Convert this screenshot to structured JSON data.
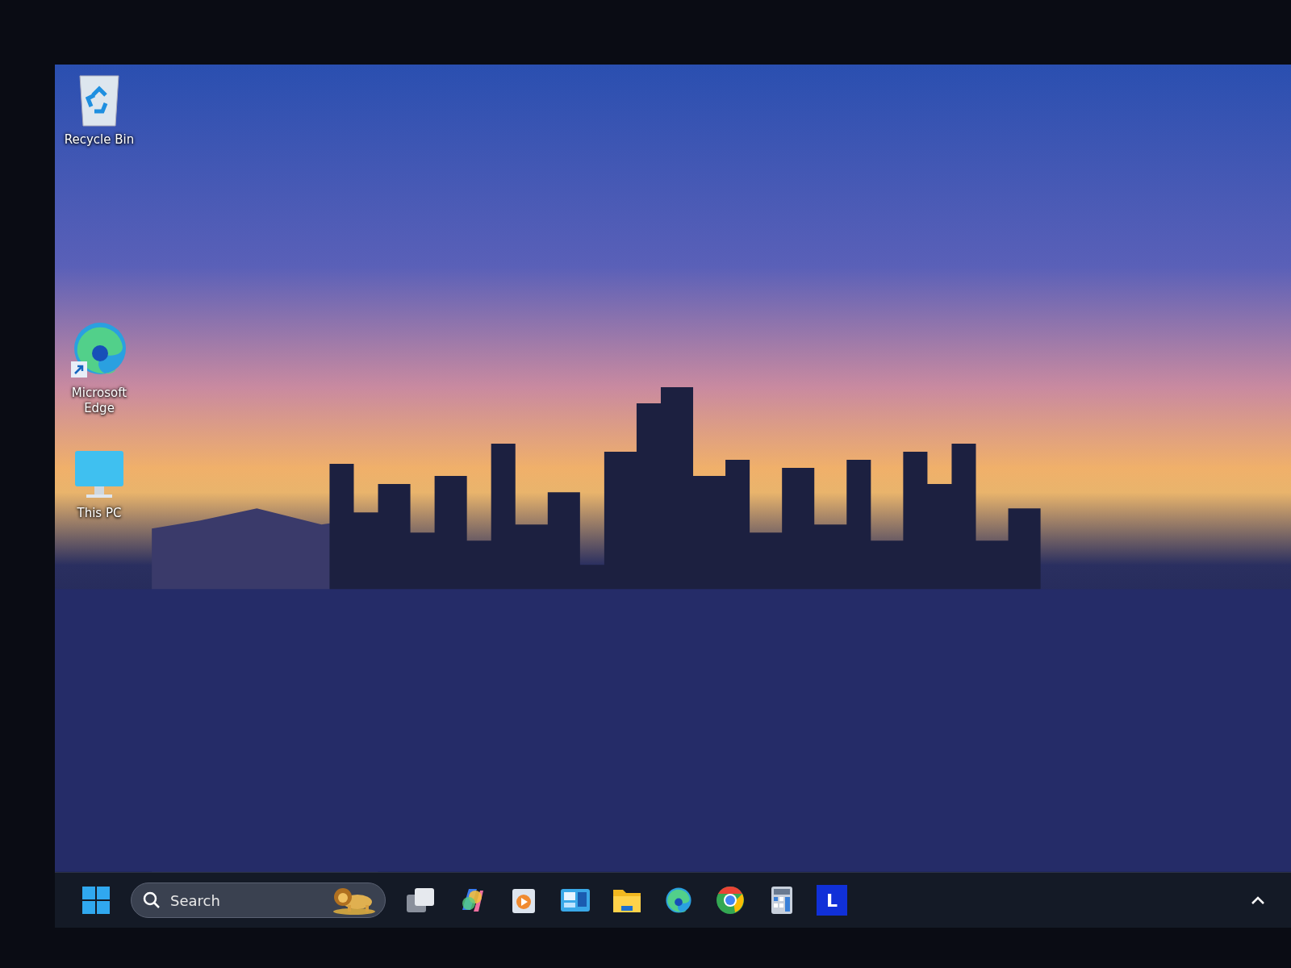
{
  "desktop_icons": [
    {
      "kind": "recycle-bin",
      "label": "Recycle Bin"
    },
    {
      "kind": "edge",
      "label": "Microsoft Edge"
    },
    {
      "kind": "monitor",
      "label": "This PC"
    }
  ],
  "taskbar": {
    "search": {
      "placeholder": "Search"
    },
    "apps": [
      {
        "kind": "task-view"
      },
      {
        "kind": "copilot"
      },
      {
        "kind": "player"
      },
      {
        "kind": "widgets"
      },
      {
        "kind": "folder"
      },
      {
        "kind": "edge"
      },
      {
        "kind": "chrome"
      },
      {
        "kind": "calculator"
      },
      {
        "kind": "letter",
        "text": "L"
      }
    ]
  }
}
